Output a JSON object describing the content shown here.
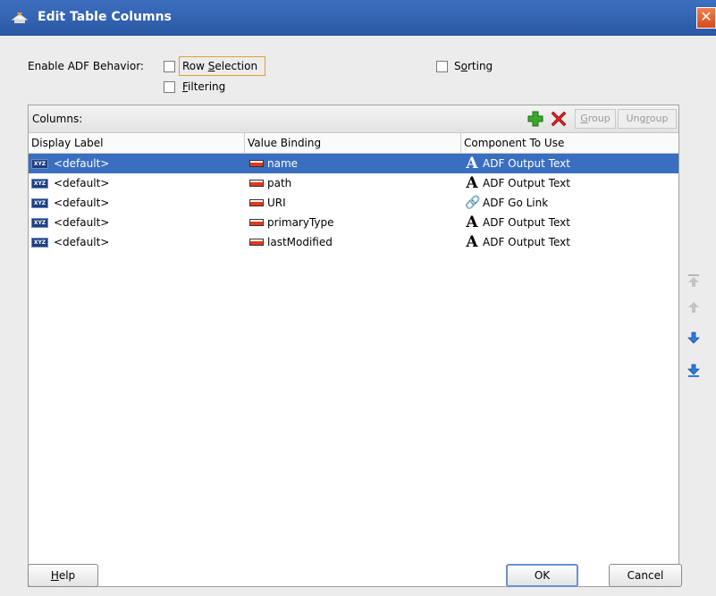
{
  "window": {
    "title": "Edit Table Columns",
    "close_glyph": "✕"
  },
  "behavior": {
    "label": "Enable ADF Behavior:",
    "row_selection_pre": "Row ",
    "row_selection_mnemonic": "S",
    "row_selection_post": "election",
    "filtering_mnemonic": "F",
    "filtering_post": "iltering",
    "sorting_pre": "S",
    "sorting_mnemonic": "o",
    "sorting_post": "rting"
  },
  "columns_panel": {
    "caption": "Columns:",
    "group_pre": "",
    "group_mnemonic": "G",
    "group_post": "roup",
    "ungroup_pre": "Ung",
    "ungroup_mnemonic": "r",
    "ungroup_post": "oup",
    "headers": [
      "Display Label",
      "Value Binding",
      "Component To Use"
    ],
    "rows": [
      {
        "display": "<default>",
        "binding": "name",
        "component": "ADF Output Text",
        "icon": "text-A-icon",
        "selected": true
      },
      {
        "display": "<default>",
        "binding": "path",
        "component": "ADF Output Text",
        "icon": "text-A-icon",
        "selected": false
      },
      {
        "display": "<default>",
        "binding": "URI",
        "component": "ADF Go Link",
        "icon": "link-icon",
        "selected": false
      },
      {
        "display": "<default>",
        "binding": "primaryType",
        "component": "ADF Output Text",
        "icon": "text-A-icon",
        "selected": false
      },
      {
        "display": "<default>",
        "binding": "lastModified",
        "component": "ADF Output Text",
        "icon": "text-A-icon",
        "selected": false
      }
    ]
  },
  "footer": {
    "help_mnemonic": "H",
    "help_post": "elp",
    "ok": "OK",
    "cancel": "Cancel"
  },
  "colors": {
    "titlebar": "#2a58a4",
    "selection": "#3a6ec0",
    "close": "#d84a1c",
    "add": "#3aa82a",
    "delete": "#d42020"
  }
}
